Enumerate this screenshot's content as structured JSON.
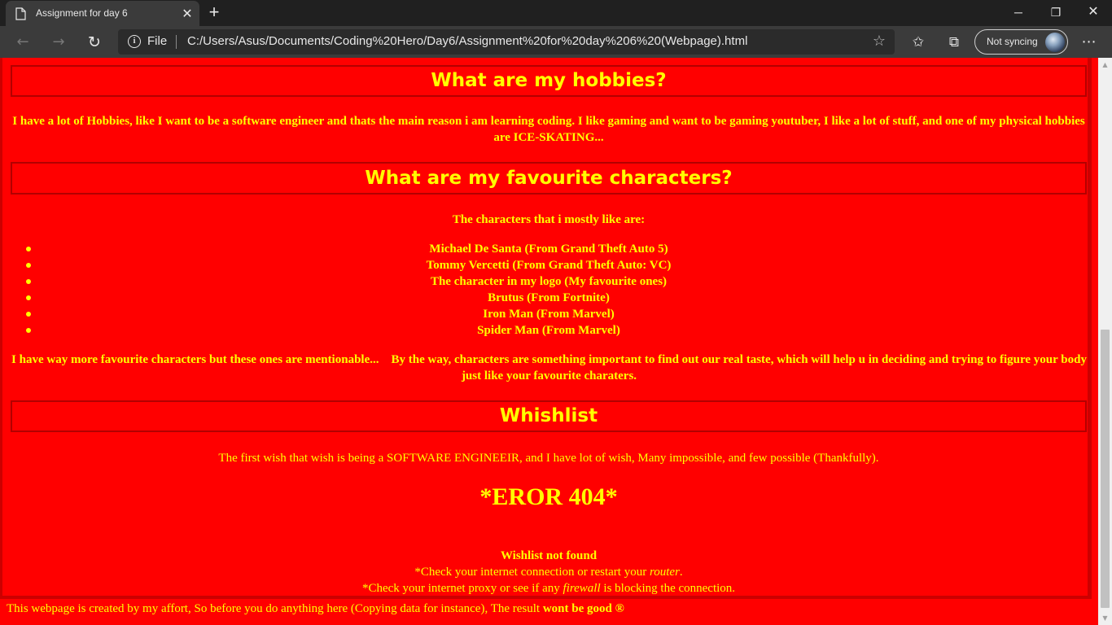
{
  "browser": {
    "tab_title": "Assignment for day 6",
    "tab_close": "✕",
    "new_tab": "+",
    "window": {
      "minimize": "─",
      "maximize": "❐",
      "close": "✕"
    },
    "nav": {
      "back": "←",
      "forward": "→",
      "reload": "↻"
    },
    "address": {
      "info_icon": "i",
      "scheme_label": "File",
      "url": "C:/Users/Asus/Documents/Coding%20Hero/Day6/Assignment%20for%20day%206%20(Webpage).html",
      "favorite_star": "☆"
    },
    "favorites_icon": "✩",
    "collections_icon": "⧉",
    "sync_label": "Not syncing",
    "more_icon": "⋯",
    "scroll_position_fraction": 0.53
  },
  "page": {
    "background_color": "#ff0000",
    "text_color": "#ffff00",
    "hobbies": {
      "heading": "What are my hobbies?",
      "text": "I have a lot of Hobbies, like I want to be a software engineer and thats the main reason i am learning coding. I like gaming and want to be gaming youtuber, I like a lot of stuff, and one of my physical hobbies are ICE-SKATING..."
    },
    "characters": {
      "heading": "What are my favourite characters?",
      "intro": "The characters that i mostly like are:",
      "list": [
        "Michael De Santa (From Grand Theft Auto 5)",
        "Tommy Vercetti (From Grand Theft Auto: VC)",
        "The character in my logo (My favourite ones)",
        "Brutus (From Fortnite)",
        "Iron Man (From Marvel)",
        "Spider Man (From Marvel)"
      ],
      "more_text": "I have way more favourite characters but these ones are mentionable...    By the way, characters are something important to find out our real taste, which will help u in deciding and trying to figure your body just like your favourite charaters."
    },
    "wishlist": {
      "heading": "Whishlist",
      "text": "The first wish that wish is being a SOFTWARE ENGINEEIR, and I have lot of wish, Many impossible, and few possible (Thankfully).",
      "error_title": "*EROR 404*",
      "not_found": "Wishlist not found",
      "check1_prefix": "*Check your internet connection or restart your ",
      "check1_italic": "router",
      "check1_suffix": ".",
      "check2_prefix": "*Check your internet proxy or see if any ",
      "check2_italic": "firewall",
      "check2_suffix": " is blocking the connection."
    },
    "footer": {
      "text": "This webpage is created by my affort, So before you do anything here (Copying data for instance), The result ",
      "bold": "wont be good ®"
    }
  }
}
